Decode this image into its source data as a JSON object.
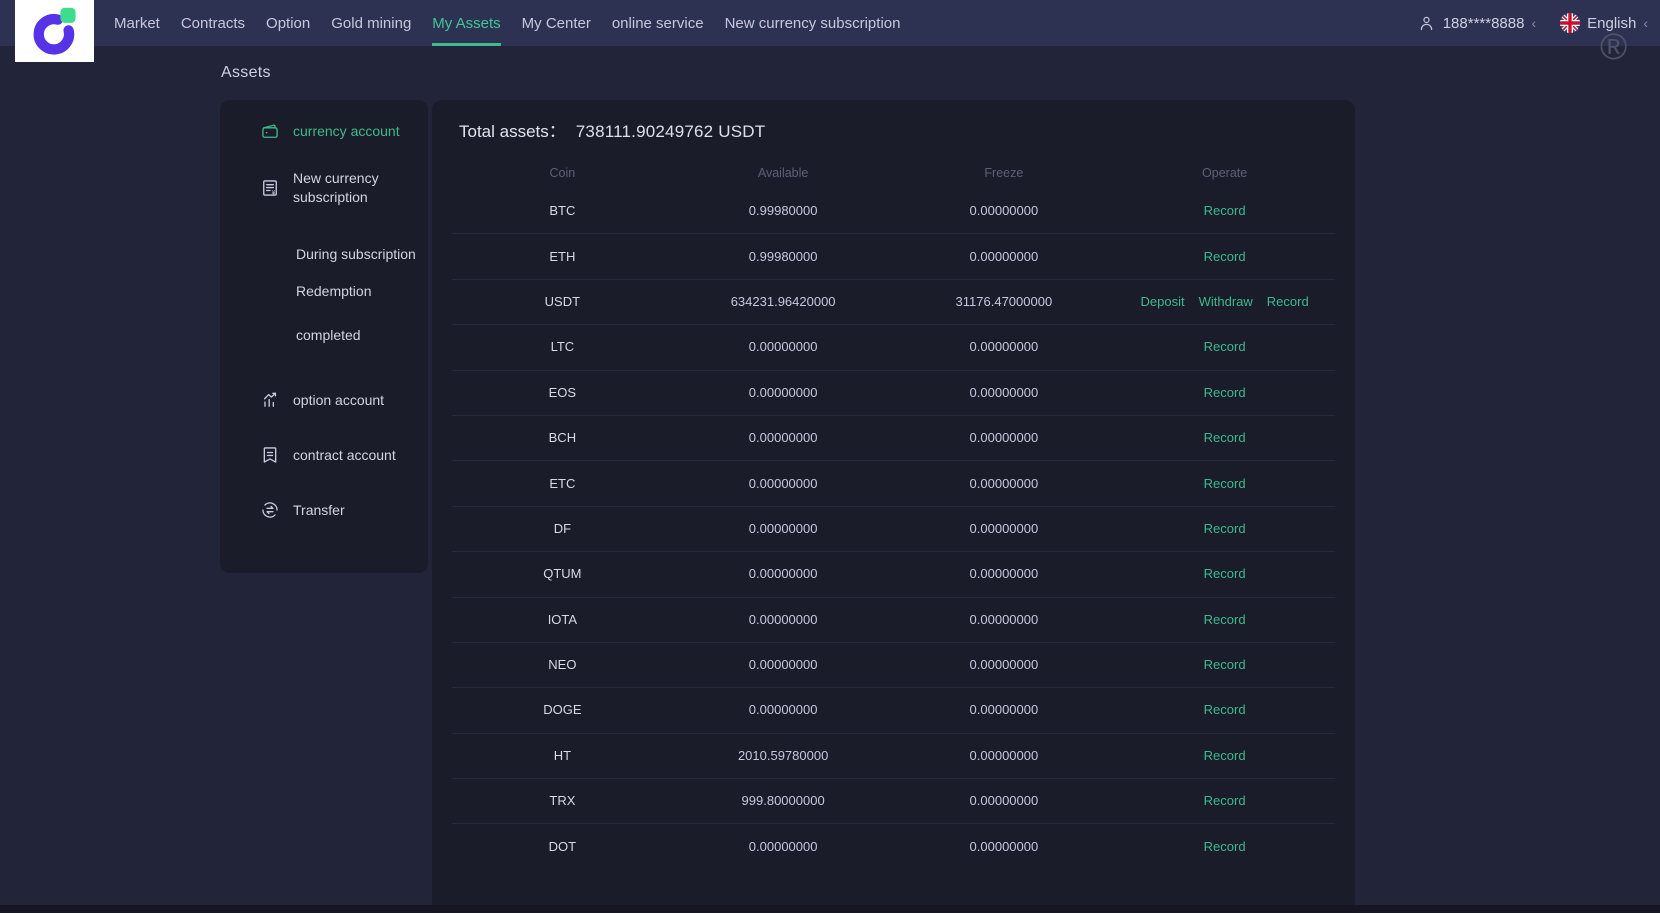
{
  "nav": {
    "items": [
      {
        "label": "Market"
      },
      {
        "label": "Contracts"
      },
      {
        "label": "Option"
      },
      {
        "label": "Gold mining"
      },
      {
        "label": "My Assets",
        "active": true
      },
      {
        "label": "My Center"
      },
      {
        "label": "online service"
      },
      {
        "label": "New currency subscription"
      }
    ],
    "user_phone": "188****8888",
    "phone_chevron": "‹",
    "language": "English",
    "language_chevron": "‹",
    "registered_mark": "®"
  },
  "page": {
    "title": "Assets"
  },
  "sidebar": {
    "items": [
      {
        "label": "currency account",
        "icon": "wallet-icon",
        "active": true
      },
      {
        "label": "New currency subscription",
        "icon": "subscription-icon"
      },
      {
        "label": "During subscription",
        "sub": true
      },
      {
        "label": "Redemption",
        "sub": true
      },
      {
        "label": "completed",
        "sub": true
      },
      {
        "label": "option account",
        "icon": "chart-icon"
      },
      {
        "label": "contract account",
        "icon": "contract-icon"
      },
      {
        "label": "Transfer",
        "icon": "transfer-icon"
      }
    ]
  },
  "assets": {
    "total_label": "Total assets：",
    "total_value": "738111.90249762 USDT",
    "table": {
      "columns": [
        "Coin",
        "Available",
        "Freeze",
        "Operate"
      ],
      "rows": [
        {
          "coin": "BTC",
          "available": "0.99980000",
          "freeze": "0.00000000",
          "operations": [
            "Record"
          ]
        },
        {
          "coin": "ETH",
          "available": "0.99980000",
          "freeze": "0.00000000",
          "operations": [
            "Record"
          ]
        },
        {
          "coin": "USDT",
          "available": "634231.96420000",
          "freeze": "31176.47000000",
          "operations": [
            "Deposit",
            "Withdraw",
            "Record"
          ]
        },
        {
          "coin": "LTC",
          "available": "0.00000000",
          "freeze": "0.00000000",
          "operations": [
            "Record"
          ]
        },
        {
          "coin": "EOS",
          "available": "0.00000000",
          "freeze": "0.00000000",
          "operations": [
            "Record"
          ]
        },
        {
          "coin": "BCH",
          "available": "0.00000000",
          "freeze": "0.00000000",
          "operations": [
            "Record"
          ]
        },
        {
          "coin": "ETC",
          "available": "0.00000000",
          "freeze": "0.00000000",
          "operations": [
            "Record"
          ]
        },
        {
          "coin": "DF",
          "available": "0.00000000",
          "freeze": "0.00000000",
          "operations": [
            "Record"
          ]
        },
        {
          "coin": "QTUM",
          "available": "0.00000000",
          "freeze": "0.00000000",
          "operations": [
            "Record"
          ]
        },
        {
          "coin": "IOTA",
          "available": "0.00000000",
          "freeze": "0.00000000",
          "operations": [
            "Record"
          ]
        },
        {
          "coin": "NEO",
          "available": "0.00000000",
          "freeze": "0.00000000",
          "operations": [
            "Record"
          ]
        },
        {
          "coin": "DOGE",
          "available": "0.00000000",
          "freeze": "0.00000000",
          "operations": [
            "Record"
          ]
        },
        {
          "coin": "HT",
          "available": "2010.59780000",
          "freeze": "0.00000000",
          "operations": [
            "Record"
          ]
        },
        {
          "coin": "TRX",
          "available": "999.80000000",
          "freeze": "0.00000000",
          "operations": [
            "Record"
          ]
        },
        {
          "coin": "DOT",
          "available": "0.00000000",
          "freeze": "0.00000000",
          "operations": [
            "Record"
          ]
        }
      ]
    }
  },
  "colors": {
    "nav_bg": "#2e3252",
    "page_bg": "#222539",
    "panel_bg": "#1a1c29",
    "accent_green": "#3eba8c",
    "nav_active_green": "#42c595",
    "row_divider": "#272a3e",
    "header_text": "#5d6175",
    "logo_purple": "#5633e6",
    "logo_green": "#3edd8d"
  }
}
